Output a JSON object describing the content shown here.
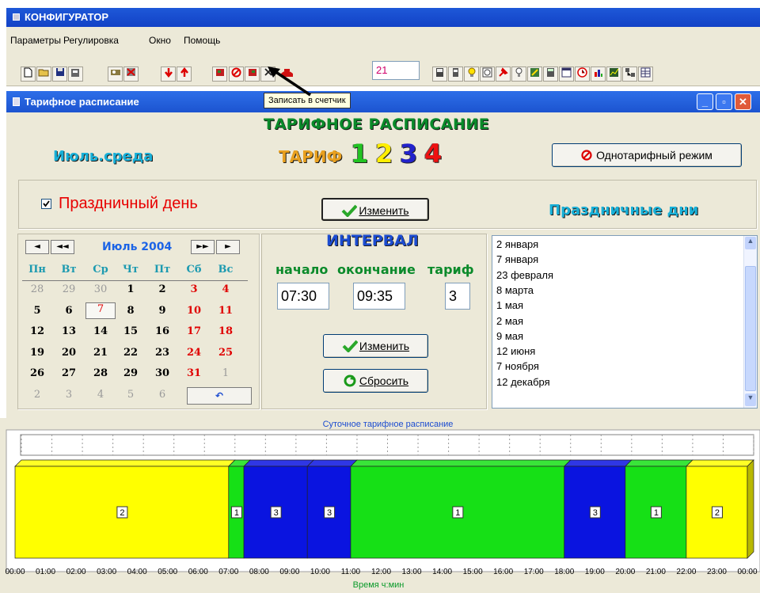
{
  "app": {
    "title": "КОНФИГУРАТОР"
  },
  "menu": [
    "Параметры",
    "Регулировка",
    "Окно",
    "Помощь"
  ],
  "toolbar": {
    "counter_value": "21",
    "tooltip": "Записать в счетчик"
  },
  "window": {
    "title": "Тарифное расписание"
  },
  "header": {
    "title": "ТАРИФНОЕ РАСПИСАНИЕ",
    "tariff_label": "ТАРИФ",
    "tariffs": [
      {
        "num": "1",
        "color": "#22c322"
      },
      {
        "num": "2",
        "color": "#ffee00"
      },
      {
        "num": "3",
        "color": "#2222cc"
      },
      {
        "num": "4",
        "color": "#ee1111"
      }
    ],
    "day_label": "Июль.среда",
    "single_tariff_button": "Однотарифный режим"
  },
  "holiday": {
    "checkbox_label": "Праздничный день",
    "checked": true,
    "change_button": "Изменить",
    "list_title": "Праздничные дни"
  },
  "calendar": {
    "month": "Июль 2004",
    "weekdays": [
      "Пн",
      "Вт",
      "Ср",
      "Чт",
      "Пт",
      "Сб",
      "Вс"
    ],
    "weeks": [
      [
        "28",
        "29",
        "30",
        "1",
        "2",
        "3",
        "4"
      ],
      [
        "5",
        "6",
        "7",
        "8",
        "9",
        "10",
        "11"
      ],
      [
        "12",
        "13",
        "14",
        "15",
        "16",
        "17",
        "18"
      ],
      [
        "19",
        "20",
        "21",
        "22",
        "23",
        "24",
        "25"
      ],
      [
        "26",
        "27",
        "28",
        "29",
        "30",
        "31",
        "1"
      ],
      [
        "2",
        "3",
        "4",
        "5",
        "6"
      ]
    ],
    "selected_day": "7",
    "nav": {
      "prev": "◄",
      "prev_year": "◄◄",
      "next_year": "►►",
      "next": "►",
      "today": "↶"
    }
  },
  "interval": {
    "title": "ИНТЕРВАЛ",
    "col_start": "начало",
    "col_end": "окончание",
    "col_tariff": "тариф",
    "start": "07:30",
    "end": "09:35",
    "tariff": "3",
    "change_button": "Изменить",
    "reset_button": "Сбросить"
  },
  "holidays": [
    "2 января",
    "7 января",
    "23 февраля",
    "8 марта",
    "1 мая",
    "2 мая",
    "9 мая",
    "12 июня",
    "7 ноября",
    "12 декабря"
  ],
  "chart_data": {
    "type": "bar",
    "title": "Суточное тарифное расписание",
    "xlabel": "Время ч:мин",
    "ticks": [
      "00:00",
      "01:00",
      "02:00",
      "03:00",
      "04:00",
      "05:00",
      "06:00",
      "07:00",
      "08:00",
      "09:00",
      "10:00",
      "11:00",
      "12:00",
      "13:00",
      "14:00",
      "15:00",
      "16:00",
      "17:00",
      "18:00",
      "19:00",
      "20:00",
      "21:00",
      "22:00",
      "23:00",
      "00:00"
    ],
    "xlim": [
      0,
      24
    ],
    "segments": [
      {
        "start": 0.0,
        "end": 7.0,
        "tariff": "2"
      },
      {
        "start": 7.0,
        "end": 7.5,
        "tariff": "1"
      },
      {
        "start": 7.5,
        "end": 9.58,
        "tariff": "3"
      },
      {
        "start": 9.58,
        "end": 11.0,
        "tariff": "3"
      },
      {
        "start": 11.0,
        "end": 18.0,
        "tariff": "1"
      },
      {
        "start": 18.0,
        "end": 20.0,
        "tariff": "3"
      },
      {
        "start": 20.0,
        "end": 22.0,
        "tariff": "1"
      },
      {
        "start": 22.0,
        "end": 24.0,
        "tariff": "2"
      }
    ],
    "colors": {
      "1": "#16e016",
      "2": "#ffff00",
      "3": "#0a14e0"
    }
  }
}
